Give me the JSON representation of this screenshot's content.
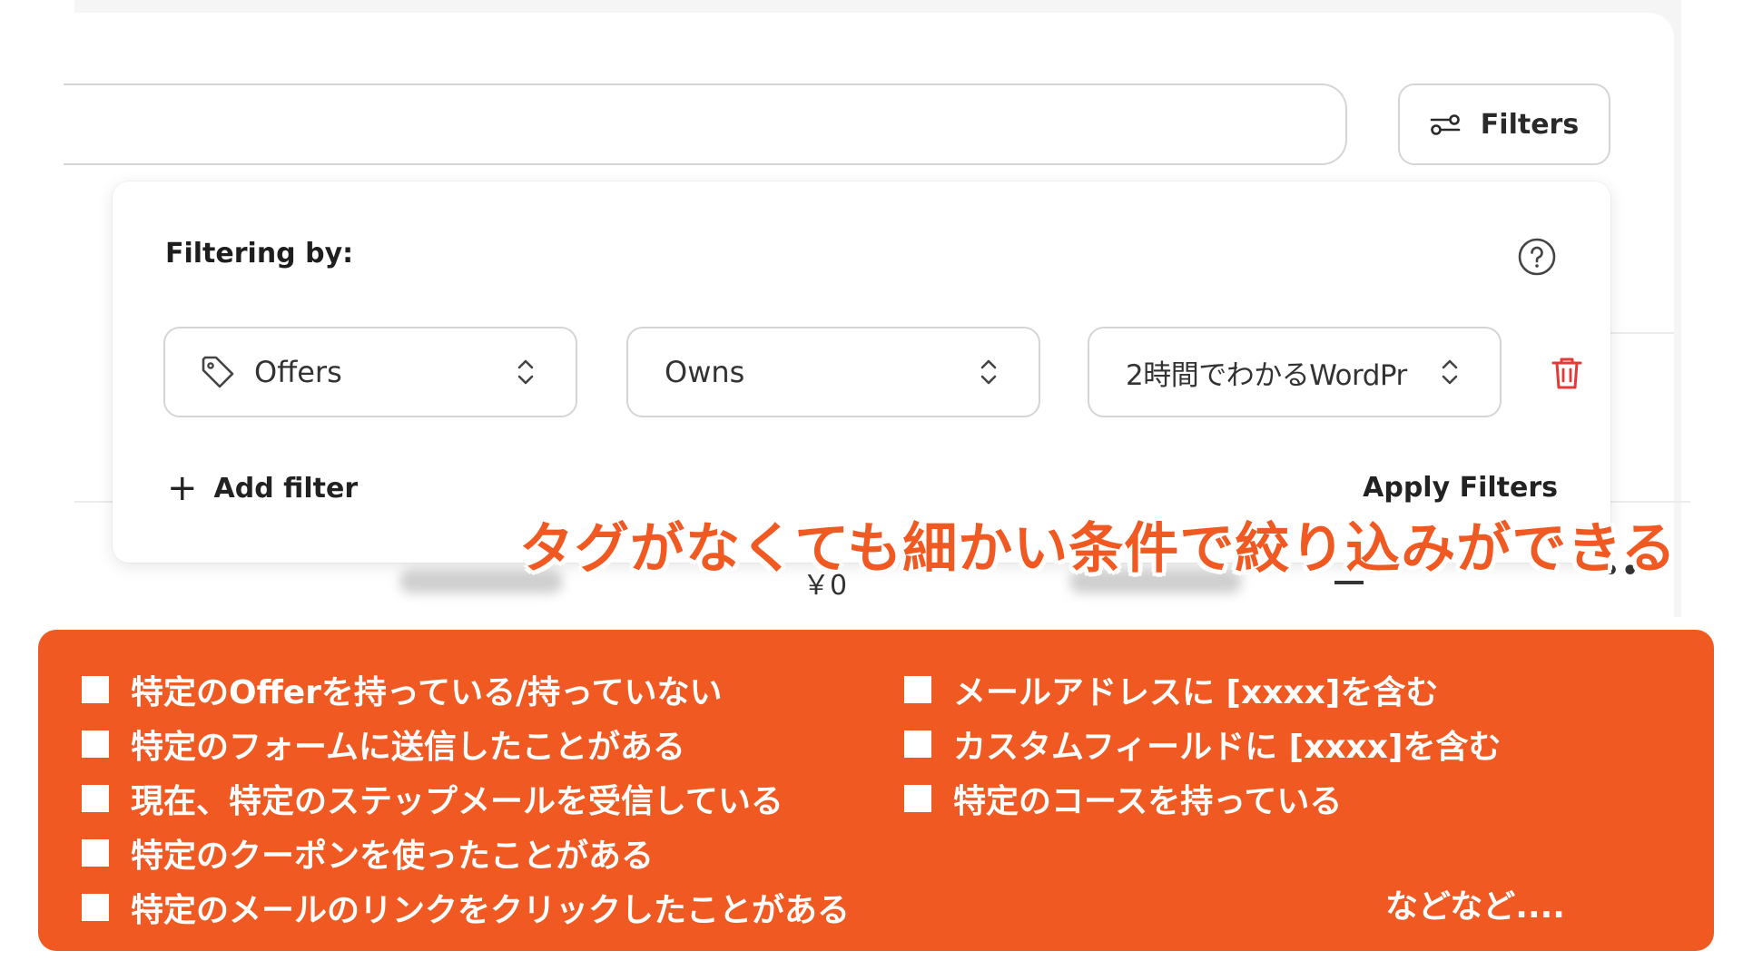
{
  "toolbar": {
    "search_value": "",
    "filters_label": "Filters"
  },
  "popover": {
    "title": "Filtering by:",
    "filter_row": {
      "field_select": "Offers",
      "operator_select": "Owns",
      "value_select": "2時間でわかるWordPr"
    },
    "add_filter_label": "Add filter",
    "apply_filters_label": "Apply Filters"
  },
  "background_row": {
    "price": "￥0"
  },
  "headline": "タグがなくても細かい条件で絞り込みができる",
  "callout": {
    "left_items": [
      "特定のOfferを持っている/持っていない",
      "特定のフォームに送信したことがある",
      "現在、特定のステップメールを受信している",
      "特定のクーポンを使ったことがある",
      "特定のメールのリンクをクリックしたことがある"
    ],
    "right_items": [
      "メールアドレスに [xxxx]を含む",
      "カスタムフィールドに [xxxx]を含む",
      "特定のコースを持っている"
    ],
    "etc_label": "などなど...."
  },
  "colors": {
    "accent_orange": "#f05a22",
    "delete_red": "#e53935",
    "border": "#d5d5d5"
  },
  "icons": [
    "filter-sliders-icon",
    "help-circle-icon",
    "tag-icon",
    "chevron-updown-icon",
    "trash-icon",
    "plus-icon"
  ]
}
